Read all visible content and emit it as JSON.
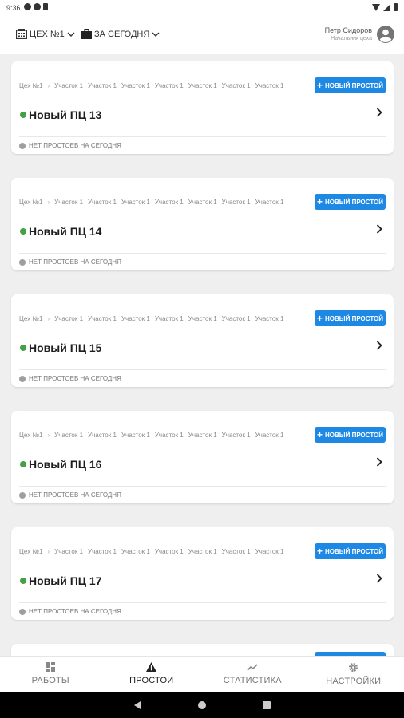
{
  "status_bar": {
    "time": "9:36"
  },
  "header": {
    "workshop_filter": "ЦЕХ №1",
    "period_filter": "ЗА СЕГОДНЯ",
    "user_name": "Петр Сидоров",
    "user_role": "Начальник цеха"
  },
  "breadcrumbs": [
    "Цех №1",
    "Участок 1",
    "Участок 1",
    "Участок 1",
    "Участок 1",
    "Участок 1",
    "Участок 1",
    "Участок 1"
  ],
  "new_button_label": "новый простой",
  "cards": [
    {
      "title": "Новый ПЦ 13",
      "status": "НЕТ ПРОСТОЕВ НА СЕГОДНЯ"
    },
    {
      "title": "Новый ПЦ 14",
      "status": "НЕТ ПРОСТОЕВ НА СЕГОДНЯ"
    },
    {
      "title": "Новый ПЦ 15",
      "status": "НЕТ ПРОСТОЕВ НА СЕГОДНЯ"
    },
    {
      "title": "Новый ПЦ 16",
      "status": "НЕТ ПРОСТОЕВ НА СЕГОДНЯ"
    },
    {
      "title": "Новый ПЦ 17",
      "status": "НЕТ ПРОСТОЕВ НА СЕГОДНЯ"
    },
    {
      "title": "",
      "status": ""
    }
  ],
  "bottom_nav": [
    {
      "label": "РАБОТЫ",
      "icon": "grid-icon"
    },
    {
      "label": "ПРОСТОИ",
      "icon": "warning-icon"
    },
    {
      "label": "СТАТИСТИКА",
      "icon": "trend-icon"
    },
    {
      "label": "НАСТРОЙКИ",
      "icon": "gear-icon"
    }
  ],
  "colors": {
    "accent": "#1e88e5",
    "status_ok": "#43a047",
    "status_none": "#9e9e9e"
  }
}
